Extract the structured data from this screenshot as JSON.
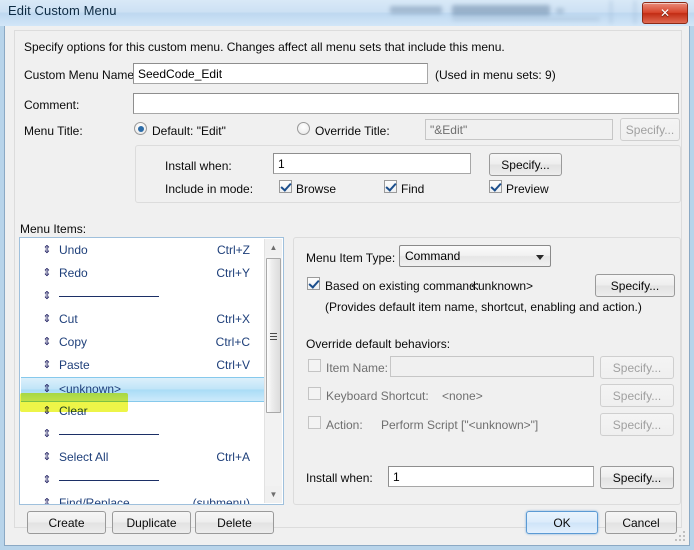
{
  "window": {
    "title": "Edit Custom Menu",
    "close_label": "✕",
    "close_icon": "close-icon"
  },
  "instruction": "Specify options for this custom menu. Changes affect all menu sets that include this menu.",
  "fields": {
    "custom_menu_name_label": "Custom Menu Name:",
    "custom_menu_name_value": "SeedCode_Edit",
    "used_in_menu_sets": "(Used in menu sets: 9)",
    "comment_label": "Comment:",
    "comment_value": "",
    "menu_title_label": "Menu Title:",
    "default_radio_label": "Default: \"Edit\"",
    "override_radio_label": "Override Title:",
    "override_value": "\"&Edit\"",
    "override_specify": "Specify..."
  },
  "install_group": {
    "install_when_label": "Install when:",
    "install_when_value": "1",
    "install_specify": "Specify...",
    "include_in_mode_label": "Include in mode:",
    "modes": [
      {
        "label": "Browse",
        "checked": true
      },
      {
        "label": "Find",
        "checked": true
      },
      {
        "label": "Preview",
        "checked": true
      }
    ]
  },
  "menu_items": {
    "label": "Menu Items:",
    "items": [
      {
        "name": "Undo",
        "shortcut": "Ctrl+Z",
        "type": "command",
        "selected": false
      },
      {
        "name": "Redo",
        "shortcut": "Ctrl+Y",
        "type": "command",
        "selected": false
      },
      {
        "name": "",
        "shortcut": "",
        "type": "separator",
        "selected": false
      },
      {
        "name": "Cut",
        "shortcut": "Ctrl+X",
        "type": "command",
        "selected": false
      },
      {
        "name": "Copy",
        "shortcut": "Ctrl+C",
        "type": "command",
        "selected": false
      },
      {
        "name": "Paste",
        "shortcut": "Ctrl+V",
        "type": "command",
        "selected": false
      },
      {
        "name": "<unknown>",
        "shortcut": "",
        "type": "command",
        "selected": true
      },
      {
        "name": "Clear",
        "shortcut": "",
        "type": "command",
        "selected": false
      },
      {
        "name": "",
        "shortcut": "",
        "type": "separator",
        "selected": false
      },
      {
        "name": "Select All",
        "shortcut": "Ctrl+A",
        "type": "command",
        "selected": false
      },
      {
        "name": "",
        "shortcut": "",
        "type": "separator",
        "selected": false
      },
      {
        "name": "Find/Replace",
        "shortcut": "(submenu)",
        "type": "submenu",
        "selected": false
      }
    ],
    "drag_handle_glyph": "⇕",
    "scroll_up_glyph": "▲",
    "scroll_down_glyph": "▼"
  },
  "detail": {
    "menu_item_type_label": "Menu Item Type:",
    "menu_item_type_value": "Command",
    "based_on_label": "Based on existing command:",
    "based_on_value": "<unknown>",
    "based_on_checked": true,
    "based_on_specify": "Specify...",
    "provides_note": "(Provides default item name, shortcut, enabling and action.)",
    "override_header": "Override default behaviors:",
    "overrides": [
      {
        "label": "Item Name:",
        "value": "",
        "is_input": true,
        "checked": false,
        "specify": "Specify..."
      },
      {
        "label": "Keyboard Shortcut:",
        "value": "<none>",
        "is_input": false,
        "checked": false,
        "specify": "Specify..."
      },
      {
        "label": "Action:",
        "value": "Perform Script [\"<unknown>\"]",
        "is_input": false,
        "checked": false,
        "specify": "Specify..."
      }
    ],
    "install_when_label": "Install when:",
    "install_when_value": "1",
    "install_specify": "Specify..."
  },
  "footer": {
    "create": "Create",
    "duplicate": "Duplicate",
    "delete": "Delete",
    "ok": "OK",
    "cancel": "Cancel"
  },
  "colors": {
    "accent": "#2c6ca8",
    "item_text": "#1e3f7a",
    "selection": "#a9dcf6",
    "highlighter": "#e8f214",
    "close_red": "#d8452c"
  }
}
